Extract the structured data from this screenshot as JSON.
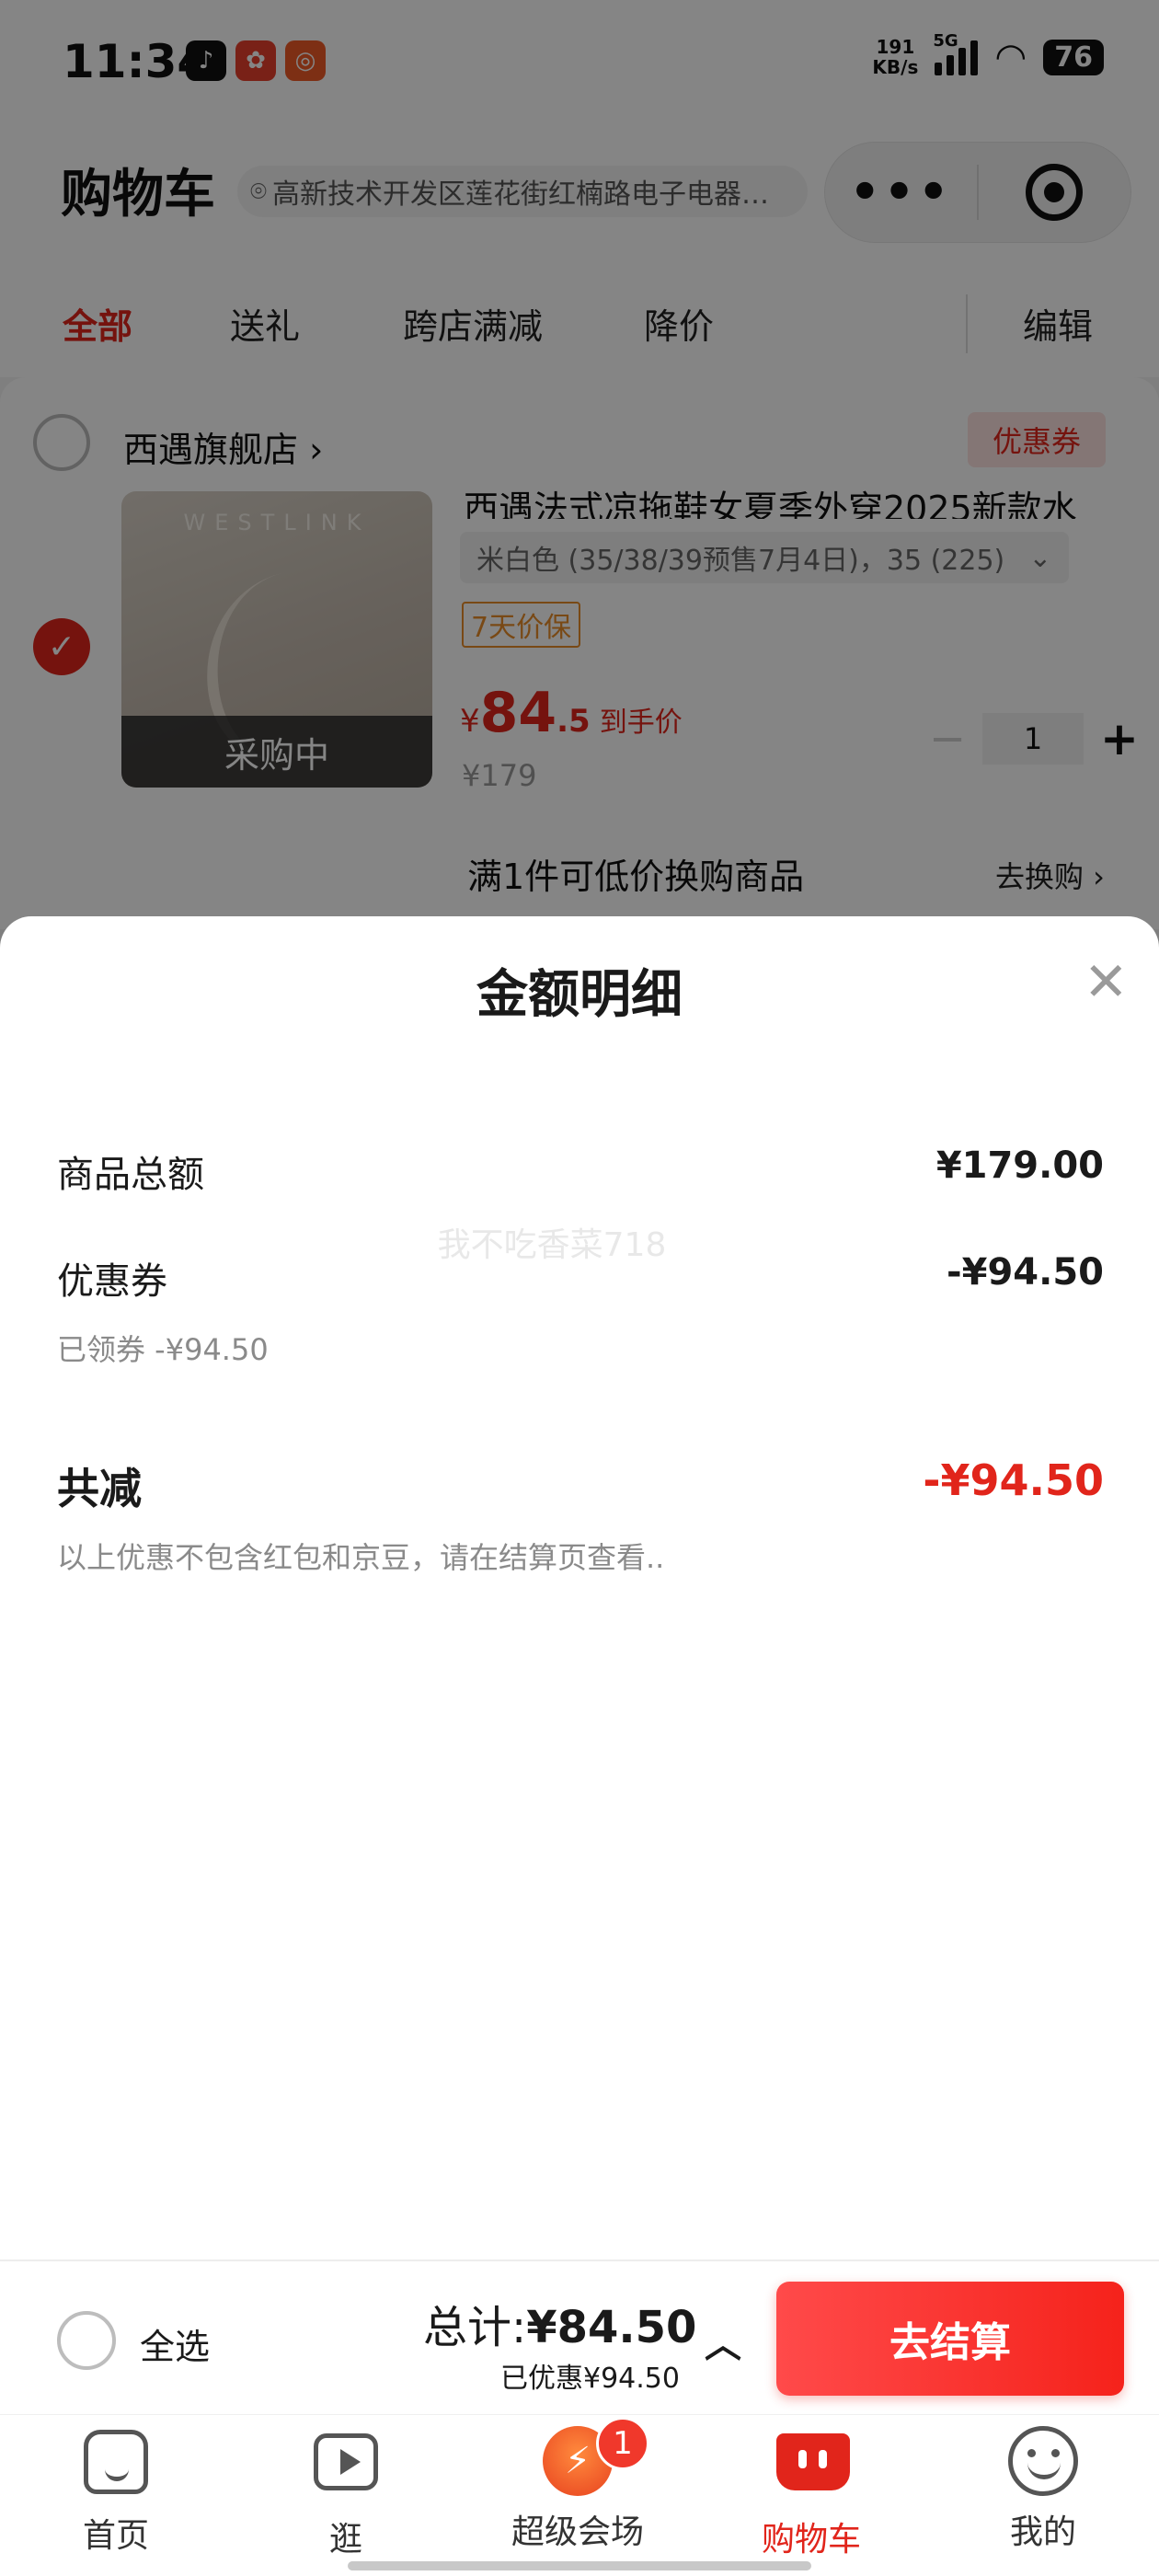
{
  "status_bar": {
    "time": "11:34",
    "net_speed_value": "191",
    "net_speed_unit": "KB/s",
    "network": "5G",
    "battery": "76",
    "apps": [
      "tiktok-icon",
      "kuaishou-icon",
      "pinduoduo-icon"
    ]
  },
  "header": {
    "title": "购物车",
    "address": "高新技术开发区莲花街红楠路电子电器…",
    "more_label": "•••"
  },
  "tabs": [
    {
      "label": "全部",
      "active": true
    },
    {
      "label": "送礼",
      "active": false
    },
    {
      "label": "跨店满减",
      "active": false
    },
    {
      "label": "降价",
      "active": false
    }
  ],
  "edit_label": "编辑",
  "store": {
    "name": "西遇旗舰店 ›",
    "coupon_tag": "优惠券"
  },
  "product": {
    "brand_on_image": "WESTLINK",
    "status_overlay": "采购中",
    "title": "西遇法式凉拖鞋女夏季外穿2025新款水",
    "spec": "米白色 (35/38/39预售7月4日)，35 (225)",
    "spec_chevron": "⌄",
    "guarantee": "7天价保",
    "price_currency": "¥",
    "price_int": "84",
    "price_dec": ".5",
    "price_tag": "到手价",
    "original_price": "¥179",
    "quantity": "1",
    "minus": "−",
    "plus": "+"
  },
  "swap": {
    "text": "满1件可低价换购商品",
    "link": "去换购 ›"
  },
  "sheet": {
    "title": "金额明细",
    "close": "✕",
    "watermark": "我不吃香菜718",
    "goods_total_label": "商品总额",
    "goods_total_value": "¥179.00",
    "coupon_label": "优惠券",
    "coupon_value": "-¥94.50",
    "coupon_sub": "已领券 -¥94.50",
    "total_reduce_label": "共减",
    "total_reduce_value": "-¥94.50",
    "note": "以上优惠不包含红包和京豆，请在结算页查看.."
  },
  "checkout": {
    "select_all": "全选",
    "total_prefix": "总计:",
    "total_value": "¥84.50",
    "saved": "已优惠¥94.50",
    "caret": "︿",
    "pay_button": "去结算"
  },
  "tabbar": [
    {
      "label": "首页",
      "icon": "home-icon",
      "active": false
    },
    {
      "label": "逛",
      "icon": "video-icon",
      "active": false
    },
    {
      "label": "超级会场",
      "icon": "flame-icon",
      "active": false,
      "badge": "1"
    },
    {
      "label": "购物车",
      "icon": "cart-icon",
      "active": true
    },
    {
      "label": "我的",
      "icon": "profile-icon",
      "active": false
    }
  ],
  "colors": {
    "accent": "#e1251b",
    "overlay": "#000000"
  }
}
